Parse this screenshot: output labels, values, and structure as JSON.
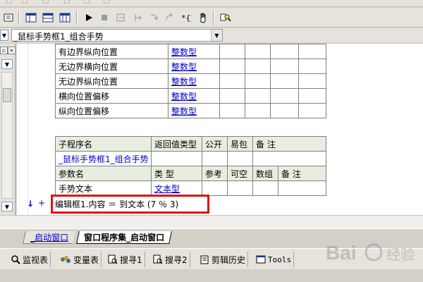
{
  "toolbar": {
    "icons": [
      "tab-icon",
      "layout-a-icon",
      "layout-b-icon",
      "layout-c-icon",
      "run-icon",
      "stop-icon",
      "step-a-icon",
      "step-b-icon",
      "step-c-icon",
      "step-d-icon",
      "brace-icon",
      "hand-icon",
      "find-icon"
    ]
  },
  "dropdown": {
    "value": "_鼠标手势框1_组合手势"
  },
  "property_rows": [
    {
      "name": "有边界纵向位置",
      "type": "整数型"
    },
    {
      "name": "无边界横向位置",
      "type": "整数型"
    },
    {
      "name": "无边界纵向位置",
      "type": "整数型"
    },
    {
      "name": "横向位置偏移",
      "type": "整数型"
    },
    {
      "name": "纵向位置偏移",
      "type": "整数型"
    }
  ],
  "sub_table": {
    "headers": [
      "子程序名",
      "返回值类型",
      "公开",
      "易包",
      "备 注"
    ],
    "sub_name": "_鼠标手势框1_组合手势",
    "param_headers": [
      "参数名",
      "类 型",
      "参考",
      "可空",
      "数组",
      "备 注"
    ],
    "param_row": {
      "name": "手势文本",
      "type": "文本型"
    }
  },
  "code_line": {
    "arrow": "↓",
    "plus": "+",
    "text": "编辑框1.内容 ＝ 到文本 (7 ％ 3)"
  },
  "tabs": {
    "inactive": "_启动窗口",
    "active": "窗口程序集_启动窗口"
  },
  "bottom_bar": {
    "items": [
      {
        "label": "监视表",
        "icon": "magnifier-icon"
      },
      {
        "label": "变量表",
        "icon": "variables-icon"
      },
      {
        "label": "搜寻1",
        "icon": "search1-icon"
      },
      {
        "label": "搜寻2",
        "icon": "search2-icon"
      },
      {
        "label": "剪辑历史",
        "icon": "clipboard-icon"
      },
      {
        "label": "Tools",
        "icon": "tools-icon"
      }
    ]
  },
  "watermark": "Bai 经验"
}
